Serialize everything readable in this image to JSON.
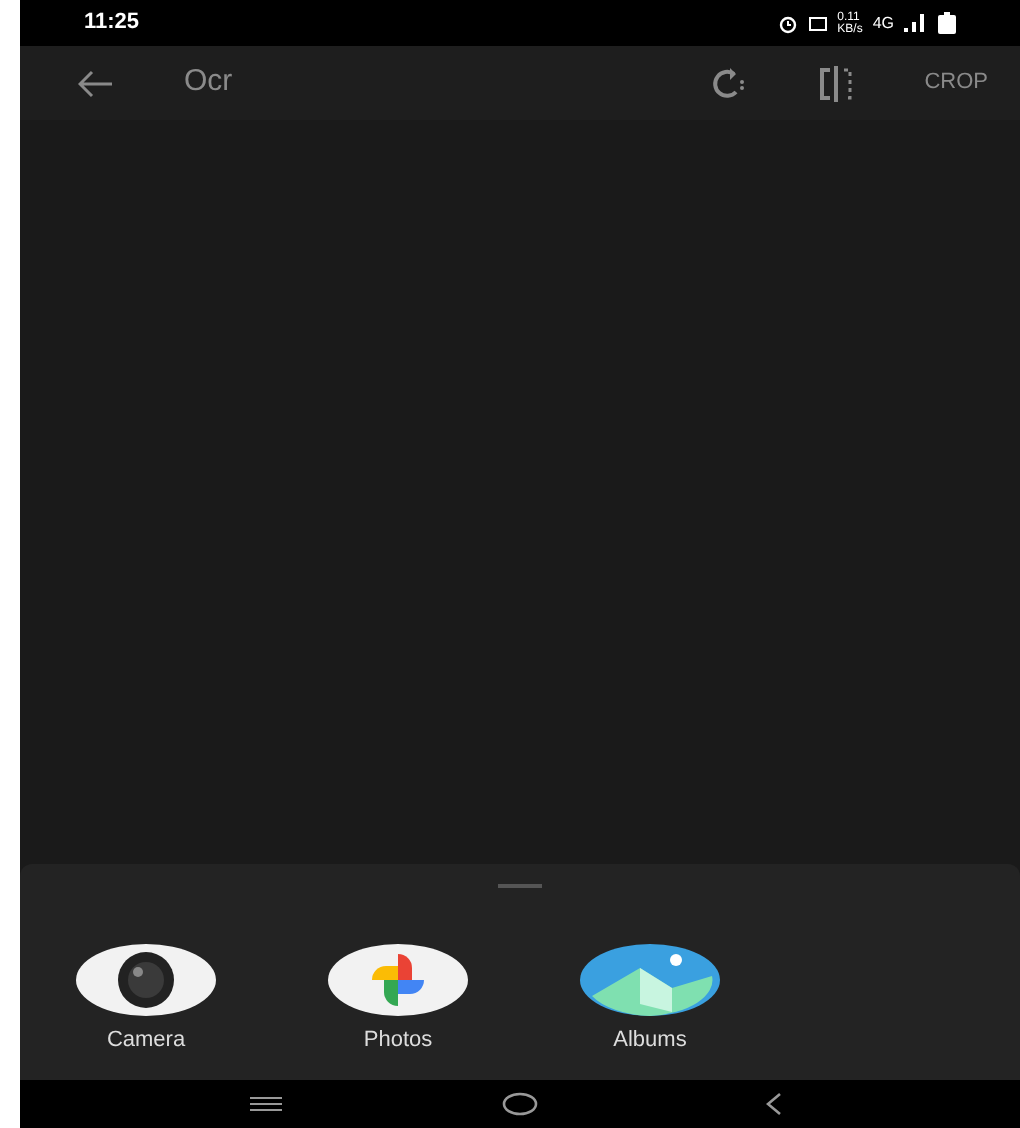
{
  "status_bar": {
    "time": "11:25",
    "speed_value": "0.11",
    "speed_unit": "KB/s",
    "network": "4G"
  },
  "toolbar": {
    "title": "Ocr",
    "action": "CROP"
  },
  "share_sheet": {
    "apps": [
      {
        "kind": "camera",
        "label": "Camera"
      },
      {
        "kind": "photos",
        "label": "Photos"
      },
      {
        "kind": "albums",
        "label": "Albums"
      }
    ]
  }
}
